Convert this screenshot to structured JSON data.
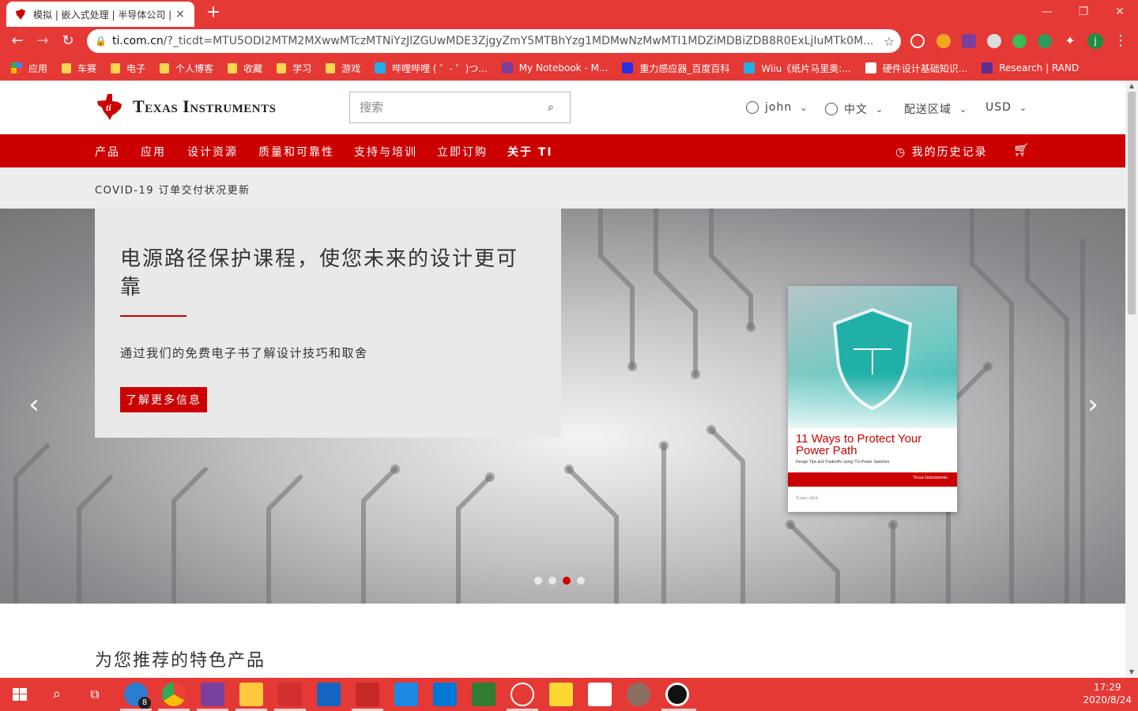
{
  "browser": {
    "tab_title": "模拟 | 嵌入式处理 | 半导体公司 |",
    "tab_close": "×",
    "new_tab": "+",
    "url_host": "ti.com.cn",
    "url_rest": "/?_ticdt=MTU5ODI2MTM2MXwwMTczMTNiYzJlZGUwMDE3ZjgyZmY5MTBhYzg1MDMwNzMwMTI1MDZiMDBiZDB8R0ExLjIuMTk0M...",
    "bookmarks": [
      {
        "label": "应用",
        "icon": "apps-icon"
      },
      {
        "label": "车赛",
        "icon": "folder-icon"
      },
      {
        "label": "电子",
        "icon": "folder-icon"
      },
      {
        "label": "个人博客",
        "icon": "folder-icon"
      },
      {
        "label": "收藏",
        "icon": "folder-icon"
      },
      {
        "label": "学习",
        "icon": "folder-icon"
      },
      {
        "label": "游戏",
        "icon": "folder-icon"
      },
      {
        "label": "哔哩哔哩 ( ゜- ゜)つ...",
        "icon": "bilibili-icon"
      },
      {
        "label": "My Notebook - M...",
        "icon": "onenote-icon"
      },
      {
        "label": "重力感应器_百度百科",
        "icon": "baidu-icon"
      },
      {
        "label": "Wiiu《纸片马里奥:...",
        "icon": "bilibili-icon"
      },
      {
        "label": "硬件设计基础知识...",
        "icon": "doc-icon"
      },
      {
        "label": "Research | RAND",
        "icon": "rand-icon"
      }
    ]
  },
  "site": {
    "logo_text": "Texas Instruments",
    "search_placeholder": "搜索",
    "user": "john",
    "language": "中文",
    "region": "配送区域",
    "currency": "USD",
    "nav": [
      "产品",
      "应用",
      "设计资源",
      "质量和可靠性",
      "支持与培训",
      "立即订购",
      "关于 TI"
    ],
    "history": "我的历史记录",
    "covid_notice": "COVID-19 订单交付状况更新",
    "hero": {
      "title": "电源路径保护课程，使您未来的设计更可靠",
      "subtitle": "通过我们的免费电子书了解设计技巧和取舍",
      "cta": "了解更多信息",
      "ebook_title": "11 Ways to Protect Your Power Path",
      "ebook_subtitle": "Design Tips and Tradeoffs Using TI's Power Switches",
      "ebook_brand": "Texas Instruments",
      "ebook_footer": "TI.com | 2019",
      "slides": 4,
      "active_slide": 3
    },
    "featured_title": "为您推荐的特色产品"
  },
  "taskbar": {
    "time": "17:29",
    "date": "2020/8/24",
    "badge": "8"
  },
  "colors": {
    "chrome_red": "#e53935",
    "ti_red": "#cc0000"
  }
}
